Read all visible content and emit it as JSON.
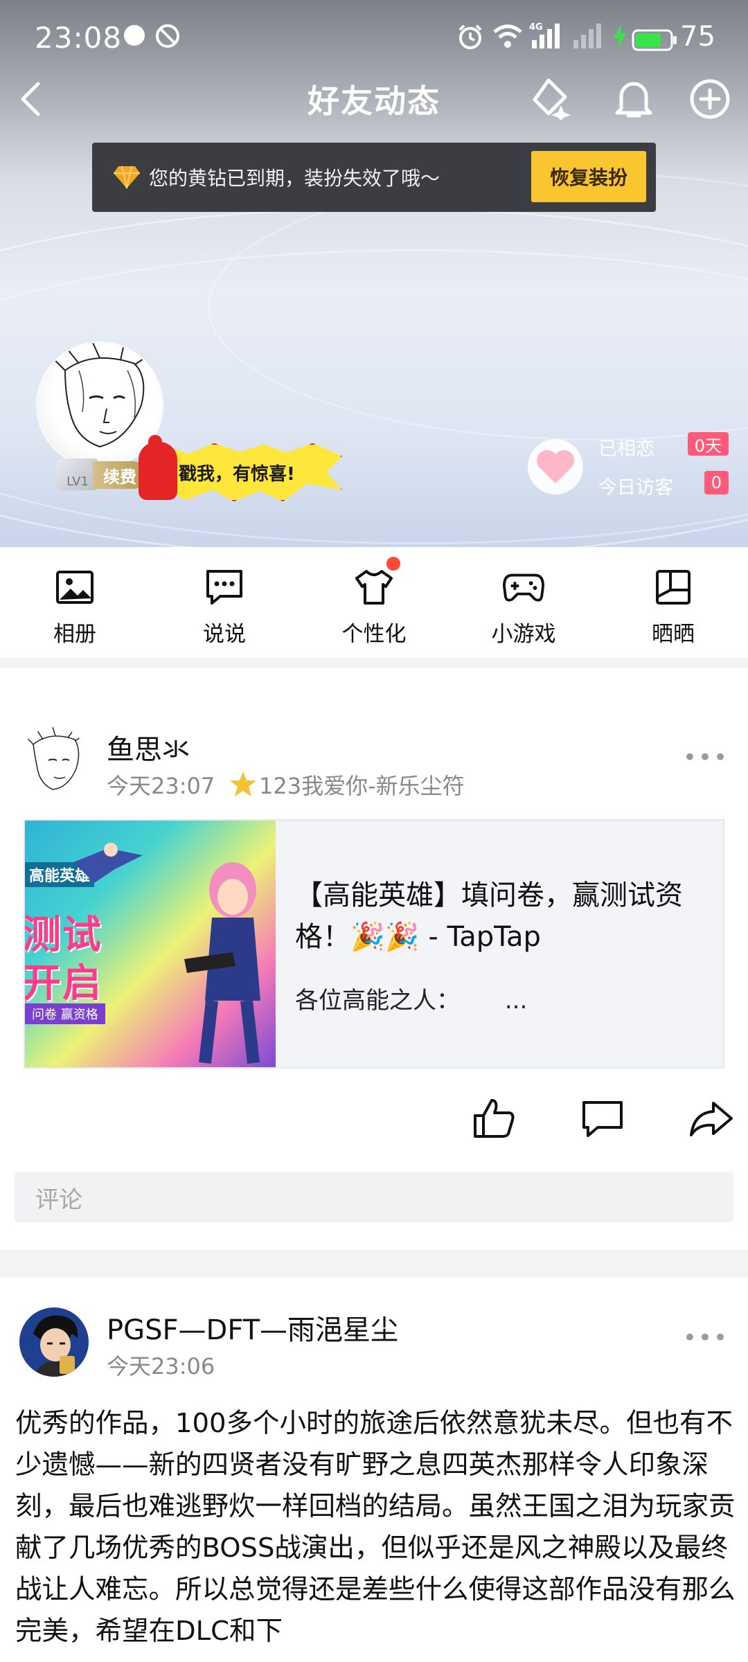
{
  "status_bar": {
    "time": "23:08",
    "network": "4G",
    "battery": "75",
    "battery_level": 0.75
  },
  "header": {
    "title": "好友动态",
    "back_icon": "chevron-left-icon",
    "actions": [
      "sparkle-icon",
      "bell-icon",
      "plus-circle-icon"
    ]
  },
  "notice": {
    "message": "您的黄钻已到期，装扮失效了哦～",
    "button": "恢复装扮"
  },
  "profile": {
    "level": "LV1",
    "renew": "续费",
    "sticker_text": "戳我，有惊喜!",
    "together_label": "已相恋",
    "together_value": "0天",
    "visitors_label": "今日访客",
    "visitors_value": "0"
  },
  "toolbar": {
    "items": [
      {
        "label": "相册",
        "icon": "image-icon"
      },
      {
        "label": "说说",
        "icon": "chat-bubble-icon"
      },
      {
        "label": "个性化",
        "icon": "tshirt-icon",
        "badge": true
      },
      {
        "label": "小游戏",
        "icon": "gamepad-icon"
      },
      {
        "label": "晒晒",
        "icon": "layout-icon"
      }
    ]
  },
  "posts": [
    {
      "author": "鱼思氺",
      "time": "今天23:07",
      "source": "123我爱你-新乐尘符",
      "more": "•••",
      "share": {
        "title": "【高能英雄】填问卷，赢测试资格！🎉🎉 - TapTap",
        "desc": "各位高能之人：      ...",
        "thumb_text_1": "高能英雄",
        "thumb_text_2": "测试",
        "thumb_text_3": "开启",
        "thumb_text_4": "问卷 赢资格"
      },
      "comment_placeholder": "评论"
    },
    {
      "author": "PGSF—DFT—雨浥星尘",
      "time": "今天23:06",
      "more": "•••",
      "text": "优秀的作品，100多个小时的旅途后依然意犹未尽。但也有不少遗憾——新的四贤者没有旷野之息四英杰那样令人印象深刻，最后也难逃野炊一样回档的结局。虽然王国之泪为玩家贡献了几场优秀的BOSS战演出，但似乎还是风之神殿以及最终战让人难忘。所以总觉得还是差些什么使得这部作品没有那么完美，希望在DLC和下"
    }
  ]
}
